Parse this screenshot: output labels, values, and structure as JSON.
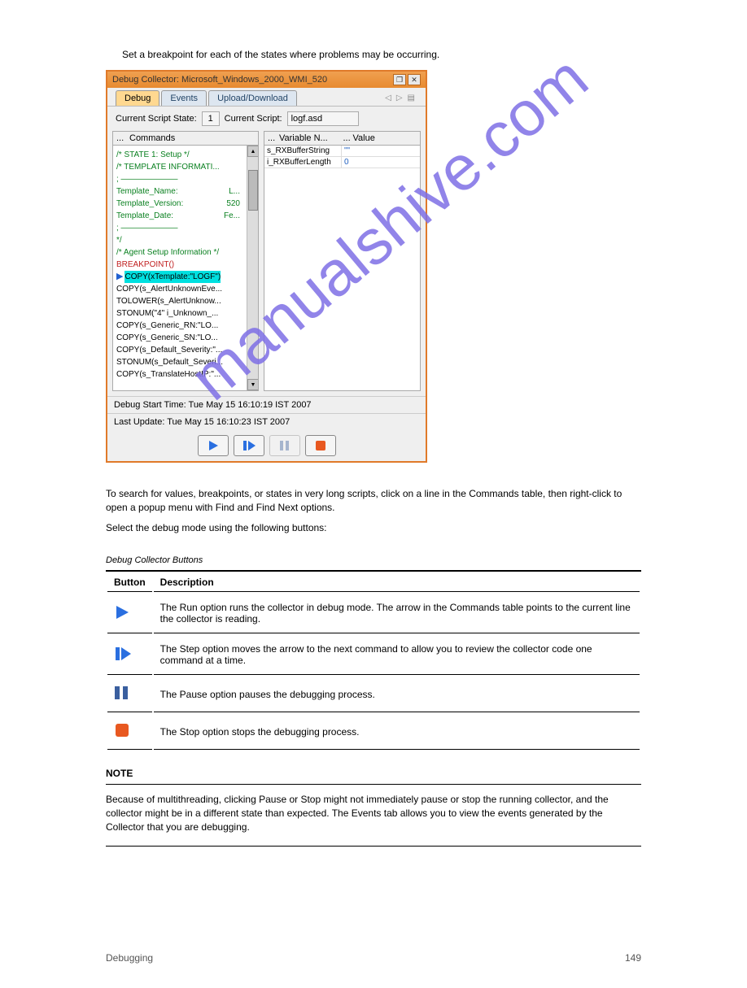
{
  "page": {
    "header_note": "Set a breakpoint for each of the states where problems may be occurring.",
    "intro1": "To search for values, breakpoints, or states in very long scripts, click on a line in the Commands table, then right-click to open a popup menu with Find and Find Next options.",
    "intro2": "Select the debug mode using the following buttons:",
    "table_caption": "Debug Collector Buttons",
    "table_header_button": "Button",
    "table_header_desc": "Description",
    "rows": [
      "The Run option runs the collector in debug mode. The arrow in the Commands table points to the current line the collector is reading.",
      "The Step option moves the arrow to the next command to allow you to review the collector code one command at a time.",
      "The Pause option pauses the debugging process.",
      "The Stop option stops the debugging process."
    ],
    "note_head": "NOTE",
    "note_body": "Because of multithreading, clicking Pause or Stop might not immediately pause or stop the running collector, and the collector might be in a different state than expected. The Events tab allows you to view the events generated by the Collector that you are debugging."
  },
  "window": {
    "title": "Debug Collector: Microsoft_Windows_2000_WMI_520",
    "tabs": [
      "Debug",
      "Events",
      "Upload/Download"
    ],
    "state_label": "Current Script State:",
    "state_value": "1",
    "script_label": "Current Script:",
    "script_value": "logf.asd",
    "col_left": "Commands",
    "col_varname": "Variable N...",
    "col_value": "Value",
    "vars": [
      {
        "name": "s_RXBufferString",
        "value": "\"\""
      },
      {
        "name": "i_RXBufferLength",
        "value": "0"
      }
    ],
    "cmds_green1": [
      "/* STATE 1:  Setup */",
      "/* TEMPLATE INFORMATI...",
      ";  ———————"
    ],
    "cmds_green2": [
      {
        "l": "Template_Name:",
        "r": "L..."
      },
      {
        "l": "Template_Version:",
        "r": "520"
      },
      {
        "l": "Template_Date:",
        "r": "Fe..."
      }
    ],
    "cmds_green3": [
      ";  ———————",
      "*/",
      "/* Agent Setup Information */"
    ],
    "cmd_break": "BREAKPOINT()",
    "cmd_hl": "COPY(xTemplate:\"LOGF\")",
    "cmds_black": [
      "COPY(s_AlertUnknownEve...",
      "TOLOWER(s_AlertUnknow...",
      "STONUM(\"4\" i_Unknown_...",
      "COPY(s_Generic_RN:\"LO...",
      "COPY(s_Generic_SN:\"LO...",
      "COPY(s_Default_Severity:\"...",
      "STONUM(s_Default_Severi...",
      "COPY(s_TranslateHostIP:\"..."
    ],
    "status1": "Debug Start Time: Tue May 15 16:10:19 IST 2007",
    "status2": "Last Update: Tue May 15 16:10:23 IST 2007"
  },
  "footer": {
    "left": "Debugging",
    "right": "149"
  }
}
